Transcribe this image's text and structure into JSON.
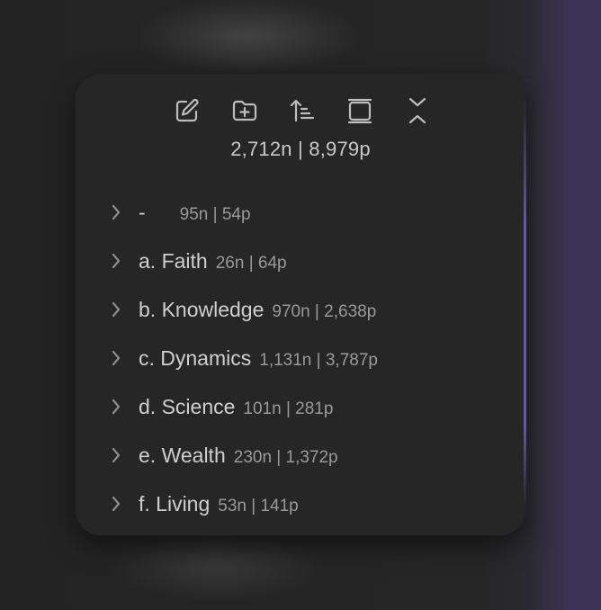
{
  "toolbar": {
    "icons": [
      "new-note-icon",
      "new-folder-icon",
      "sort-icon",
      "collapse-view-icon",
      "collapse-all-icon"
    ]
  },
  "summary": "2,712n | 8,979p",
  "tree": {
    "items": [
      {
        "name": "-",
        "count": "95n | 54p"
      },
      {
        "name": "a. Faith",
        "count": "26n | 64p"
      },
      {
        "name": "b. Knowledge",
        "count": "970n | 2,638p"
      },
      {
        "name": "c. Dynamics",
        "count": "1,131n | 3,787p"
      },
      {
        "name": "d. Science",
        "count": "101n | 281p"
      },
      {
        "name": "e. Wealth",
        "count": "230n | 1,372p"
      },
      {
        "name": "f. Living",
        "count": "53n | 141p"
      }
    ]
  },
  "colors": {
    "panel": "#262626",
    "text": "#cfcfcf",
    "muted": "#9a9a9a",
    "accent": "#6e5fb4"
  }
}
